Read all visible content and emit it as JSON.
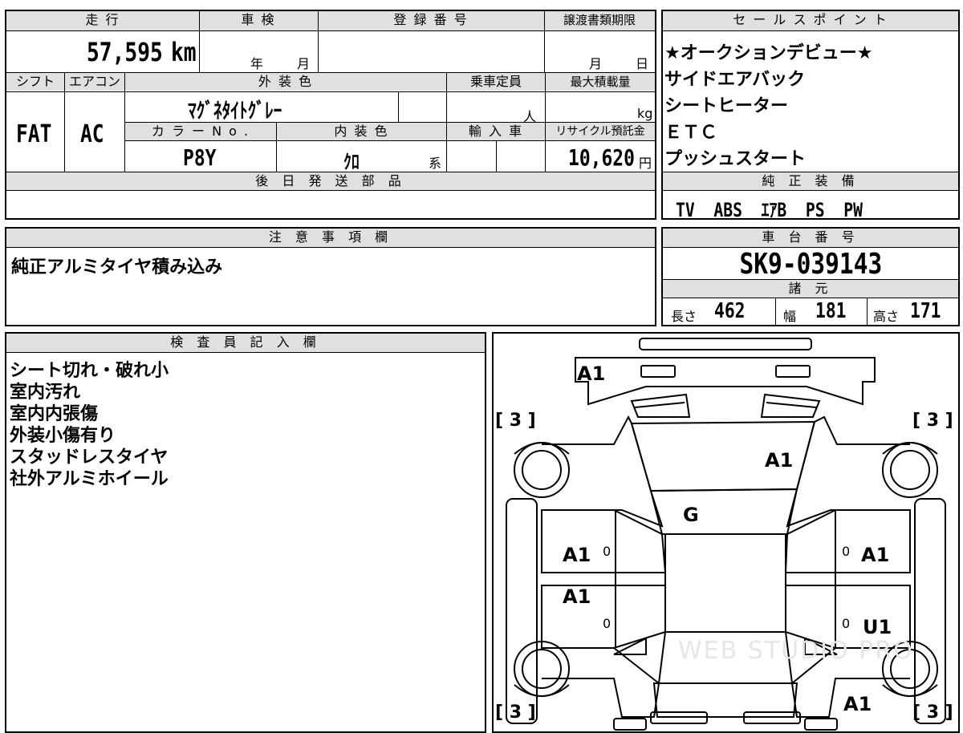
{
  "top_left": {
    "headers": {
      "mileage": "走 行",
      "inspection": "車 検",
      "registration": "登 録 番 号",
      "transfer_deadline": "譲渡書類期限"
    },
    "mileage_value": "57,595",
    "mileage_unit": "km",
    "inspection_year": "年",
    "inspection_month": "月",
    "transfer_month": "月",
    "transfer_day": "日"
  },
  "row2": {
    "headers": {
      "shift": "シフト",
      "aircon": "エアコン",
      "exterior_color": "外 装 色",
      "capacity": "乗車定員",
      "max_load": "最大積載量",
      "color_no": "カ ラ ー N o .",
      "interior_color": "内 装 色",
      "import": "輸 入 車",
      "recycle": "リサイクル預託金"
    },
    "shift_value": "FAT",
    "aircon_value": "AC",
    "exterior_color_value": "ﾏｸﾞﾈﾀｲﾄｸﾞﾚｰ",
    "capacity_unit": "人",
    "max_load_unit": "kg",
    "color_no_value": "P8Y",
    "interior_color_value": "ｸﾛ",
    "interior_suffix": "系",
    "recycle_value": "10,620",
    "recycle_unit": "円"
  },
  "later_parts": {
    "header": "後 日 発 送 部 品"
  },
  "sales_points": {
    "header": "セ ー ル ス ポ イ ン ト",
    "items": [
      "★オークションデビュー★",
      "サイドエアバック",
      "シートヒーター",
      "ＥＴＣ",
      "プッシュスタート"
    ]
  },
  "equipment": {
    "header": "純 正 装 備",
    "items": [
      "TV",
      "ABS",
      "ｴｱB",
      "PS",
      "PW"
    ]
  },
  "notes": {
    "header": "注 意 事 項 欄",
    "text": "純正アルミタイヤ積み込み"
  },
  "chassis": {
    "header": "車 台 番 号",
    "value": "SK9-039143",
    "spec_header": "諸 元",
    "length_label": "長さ",
    "length_value": "462",
    "width_label": "幅",
    "width_value": "181",
    "height_label": "高さ",
    "height_value": "171"
  },
  "inspector": {
    "header": "検 査 員 記 入 欄",
    "lines": [
      "シート切れ・破れ小",
      "室内汚れ",
      "室内内張傷",
      "外装小傷有り",
      "スタッドレスタイヤ",
      "社外アルミホイール"
    ]
  },
  "diagram": {
    "bumper_front": "A1",
    "hood": "A1",
    "windshield": "G",
    "door_front_left": "A1",
    "door_rear_left": "A1",
    "door_front_right": "A1",
    "door_rear_right": "U1",
    "quarter_rear_right": "A1",
    "tread_marks": [
      "0",
      "0",
      "0",
      "0"
    ],
    "tire_front_left": "[ 3 ]",
    "tire_front_right": "[ 3 ]",
    "tire_rear_left": "[ 3 ]",
    "tire_rear_right": "[ 3 ]",
    "watermark": "WEB STUDIO PRO"
  }
}
